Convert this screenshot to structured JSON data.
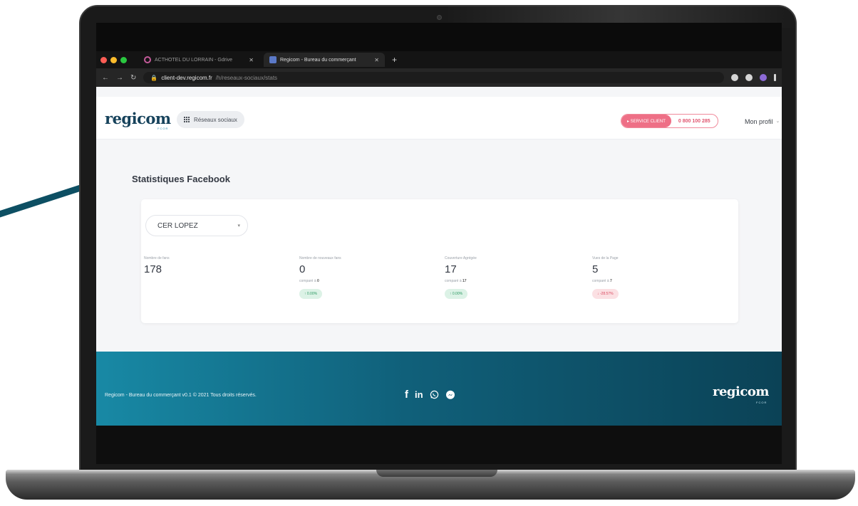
{
  "browser": {
    "tabs": [
      {
        "label": "ACTHOTEL DU LORRAIN - Gdrive"
      },
      {
        "label": "Regicom - Bureau du commerçant"
      }
    ],
    "url_host": "client-dev.regicom.fr",
    "url_path": "/h/reseaux-sociaux/stats"
  },
  "header": {
    "logo": "regicom",
    "logo_sub": "FCOR",
    "social_button": "Réseaux sociaux",
    "service_label": "▸ SERVICE CLIENT",
    "service_phone": "0 800 100 285",
    "profile": "Mon profil"
  },
  "main": {
    "title": "Statistiques Facebook",
    "selected_page": "CER LOPEZ",
    "stats": [
      {
        "label": "Nombre de fans",
        "value": "178"
      },
      {
        "label": "Nombre de nouveaux fans",
        "value": "0",
        "compare_prefix": "comparé à",
        "compare_value": "0",
        "badge": "↑ 0.00%",
        "trend": "up"
      },
      {
        "label": "Couverture Agrégée",
        "value": "17",
        "compare_prefix": "comparé à",
        "compare_value": "17",
        "badge": "↑ 0.00%",
        "trend": "up"
      },
      {
        "label": "Vues de la Page",
        "value": "5",
        "compare_prefix": "comparé à",
        "compare_value": "7",
        "badge": "↓ -28.57%",
        "trend": "down"
      }
    ]
  },
  "footer": {
    "copyright": "Regicom - Bureau du commerçant v0.1 © 2021 Tous droits réservés.",
    "logo": "regicom",
    "logo_sub": "FCOR",
    "social": {
      "facebook": "f",
      "linkedin": "in"
    }
  },
  "colors": {
    "brand": "#16425b",
    "accent_pink": "#ee6f86",
    "footer_teal": "#1889a5",
    "up_green": "#2d9a63",
    "down_red": "#d9485f"
  }
}
